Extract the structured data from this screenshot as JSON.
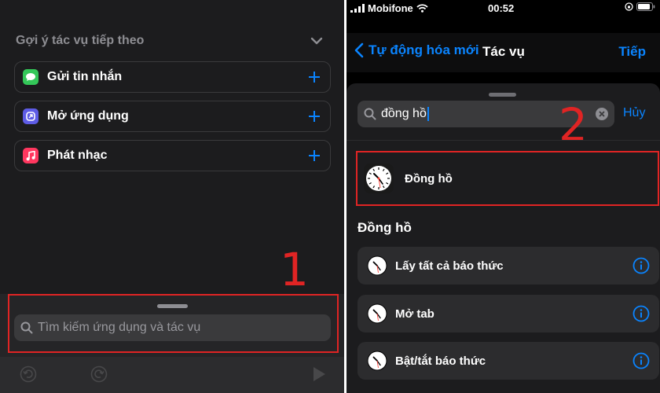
{
  "left": {
    "suggest_title": "Gợi ý tác vụ tiếp theo",
    "suggestions": [
      {
        "label": "Gửi tin nhắn",
        "icon": "messages-icon",
        "color": "#34c759"
      },
      {
        "label": "Mở ứng dụng",
        "icon": "open-app-icon",
        "color": "#5e5ce6"
      },
      {
        "label": "Phát nhạc",
        "icon": "music-icon",
        "color": "#ff375f"
      }
    ],
    "search_placeholder": "Tìm kiếm ứng dụng và tác vụ",
    "step_number": "1"
  },
  "right": {
    "status": {
      "carrier": "Mobifone",
      "time": "00:52"
    },
    "nav": {
      "back_label": "Tự động hóa mới",
      "title": "Tác vụ",
      "next_label": "Tiếp"
    },
    "search": {
      "value": "đồng hồ",
      "cancel_label": "Hủy"
    },
    "step_number": "2",
    "app_result": {
      "label": "Đồng hồ"
    },
    "section_title": "Đồng hồ",
    "actions": [
      {
        "label": "Lấy tất cả báo thức"
      },
      {
        "label": "Mở tab"
      },
      {
        "label": "Bật/tắt báo thức"
      }
    ]
  },
  "colors": {
    "accent": "#0a84ff",
    "highlight": "#e02424"
  }
}
